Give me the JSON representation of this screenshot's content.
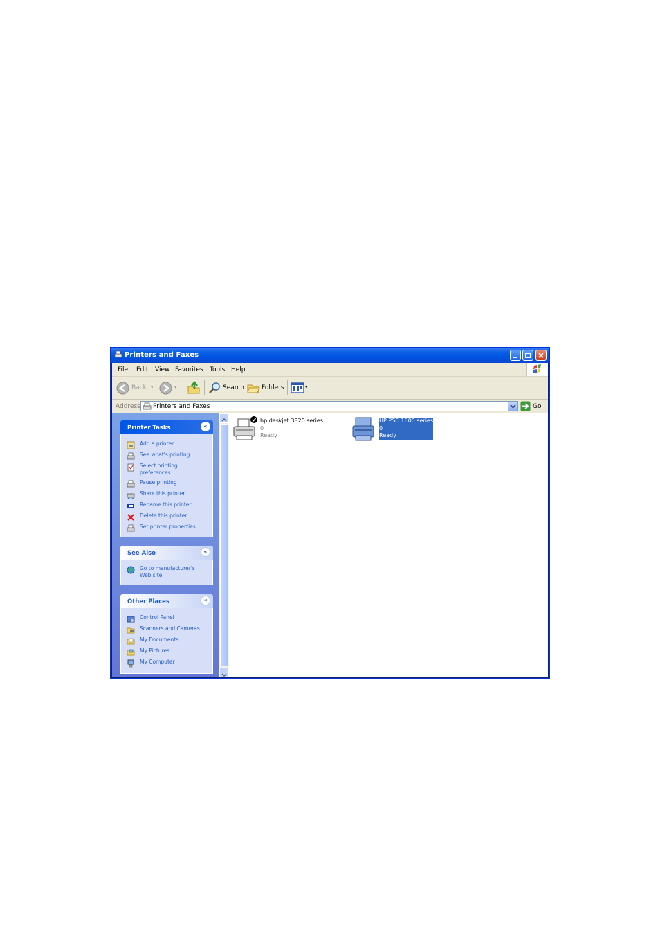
{
  "window": {
    "title": "Printers and Faxes",
    "accent": "#0054e3"
  },
  "menu": {
    "items": [
      "File",
      "Edit",
      "View",
      "Favorites",
      "Tools",
      "Help"
    ]
  },
  "toolbar": {
    "back_label": "Back",
    "search_label": "Search",
    "folders_label": "Folders"
  },
  "address": {
    "label": "Address",
    "value": "Printers and Faxes",
    "go_label": "Go"
  },
  "tasks": {
    "printer_tasks": {
      "title": "Printer Tasks",
      "items": [
        {
          "label": "Add a printer",
          "icon": "add-printer-icon"
        },
        {
          "label": "See what's printing",
          "icon": "print-queue-icon"
        },
        {
          "label": "Select printing preferences",
          "icon": "preferences-icon"
        },
        {
          "label": "Pause printing",
          "icon": "pause-printer-icon"
        },
        {
          "label": "Share this printer",
          "icon": "share-printer-icon"
        },
        {
          "label": "Rename this printer",
          "icon": "rename-icon"
        },
        {
          "label": "Delete this printer",
          "icon": "delete-icon"
        },
        {
          "label": "Set printer properties",
          "icon": "properties-icon"
        }
      ]
    },
    "see_also": {
      "title": "See Also",
      "items": [
        {
          "label": "Go to manufacturer's Web site",
          "icon": "globe-icon"
        }
      ]
    },
    "other_places": {
      "title": "Other Places",
      "items": [
        {
          "label": "Control Panel",
          "icon": "control-panel-icon"
        },
        {
          "label": "Scanners and Cameras",
          "icon": "scanner-icon"
        },
        {
          "label": "My Documents",
          "icon": "my-documents-icon"
        },
        {
          "label": "My Pictures",
          "icon": "my-pictures-icon"
        },
        {
          "label": "My Computer",
          "icon": "my-computer-icon"
        }
      ]
    }
  },
  "printers": [
    {
      "name": "hp deskjet 3820 series",
      "docs": "0",
      "status": "Ready",
      "default": true,
      "selected": false
    },
    {
      "name": "HP PSC 1600 series",
      "docs": "0",
      "status": "Ready",
      "default": false,
      "selected": true
    }
  ]
}
